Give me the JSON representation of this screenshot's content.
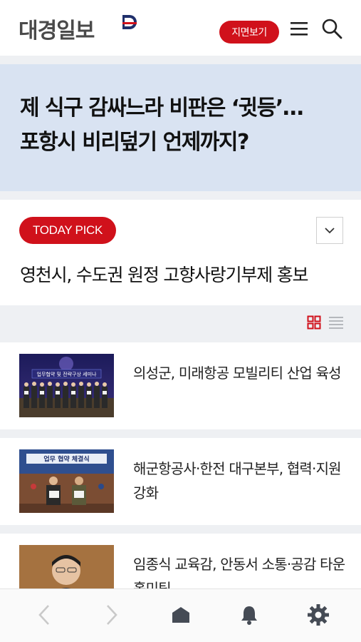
{
  "header": {
    "logo_text": "대경일보",
    "epaper_label": "지면보기",
    "brand_red": "#d0111b",
    "brand_navy": "#1f2f6b"
  },
  "hero": {
    "title_line1": "제 식구 감싸느라 비판은 ‘귓등’…",
    "title_line2": "포항시 비리덮기 언제까지?",
    "background": "#d9e3f2"
  },
  "today_pick": {
    "badge": "TODAY PICK",
    "headline": "영천시, 수도권 원정 고향사랑기부제 홍보",
    "toggle_icon": "chevron-down-icon"
  },
  "view_toggle": {
    "active": "grid",
    "grid_icon": "grid-view-icon",
    "list_icon": "list-view-icon"
  },
  "articles": [
    {
      "title": "의성군, 미래항공 모빌리티 산업 육성",
      "thumb_banner": "업무협약 및 전략구상 세미나"
    },
    {
      "title": "해군항공사·한전 대구본부, 협력·지원 강화",
      "thumb_banner": "업무 협약 체결식"
    },
    {
      "title": "임종식 교육감, 안동서 소통·공감 타운홀미팅",
      "thumb_banner": ""
    }
  ],
  "bottom_nav": {
    "items": [
      "back-arrow-icon",
      "forward-arrow-icon",
      "home-icon",
      "bell-icon",
      "gear-icon"
    ]
  }
}
